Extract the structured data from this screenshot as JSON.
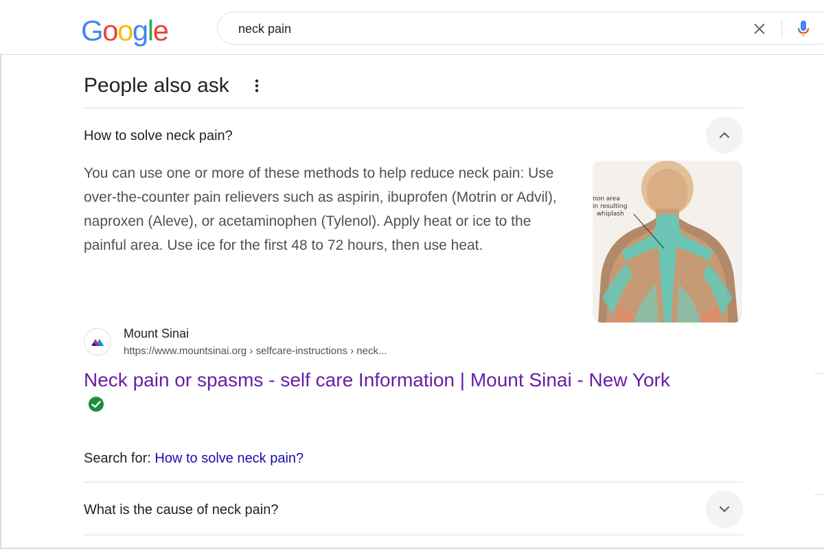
{
  "header": {
    "logo_letters": [
      {
        "char": "G",
        "color": "#4285F4"
      },
      {
        "char": "o",
        "color": "#EA4335"
      },
      {
        "char": "o",
        "color": "#FBBC05"
      },
      {
        "char": "g",
        "color": "#4285F4"
      },
      {
        "char": "l",
        "color": "#34A853"
      },
      {
        "char": "e",
        "color": "#EA4335"
      }
    ],
    "search_value": "neck pain",
    "clear_icon": "close-icon",
    "mic_icon": "microphone-icon"
  },
  "paa": {
    "title": "People also ask",
    "menu_icon": "more-vert-icon",
    "questions": [
      {
        "text": "How to solve neck pain?",
        "expanded": true
      },
      {
        "text": "What is the cause of neck pain?",
        "expanded": false
      }
    ],
    "answer": {
      "text": "You can use one or more of these methods to help reduce neck pain: Use over-the-counter pain relievers such as aspirin, ibuprofen (Motrin or Advil), naproxen (Aleve), or acetaminophen (Tylenol). Apply heat or ice to the painful area. Use ice for the first 48 to 72 hours, then use heat.",
      "image_labels": [
        "non area",
        "in resulting",
        "whiplash"
      ]
    },
    "source": {
      "name": "Mount Sinai",
      "url": "https://www.mountsinai.org › selfcare-instructions › neck...",
      "title": "Neck pain or spasms - self care Information | Mount Sinai - New York",
      "verified_icon": "verified-check-icon"
    },
    "search_for": {
      "label": "Search for:",
      "query": "How to solve neck pain?"
    }
  },
  "colors": {
    "link_visited": "#681da8",
    "link": "#1a0dab",
    "verified": "#1e8e3e"
  }
}
